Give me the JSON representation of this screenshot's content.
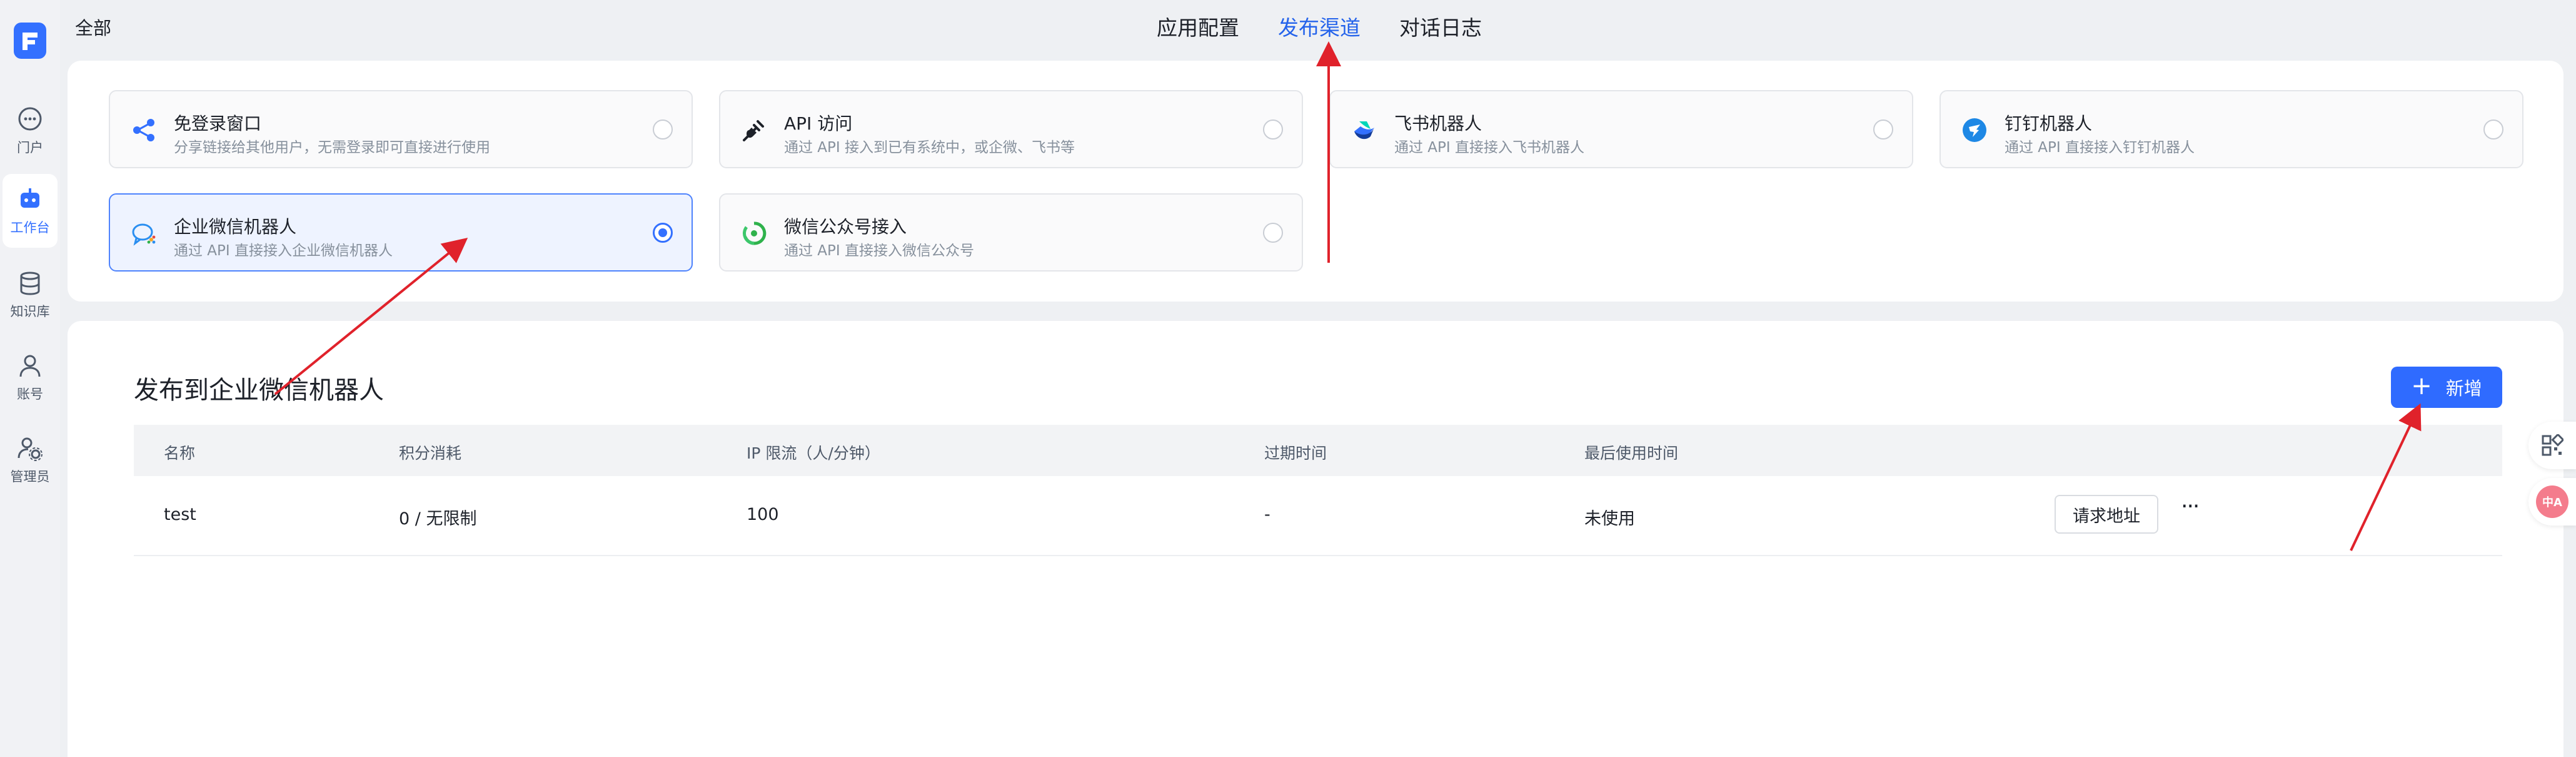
{
  "sidebar": {
    "items": [
      {
        "label": "门户",
        "icon": "chat-bubble-icon"
      },
      {
        "label": "工作台",
        "icon": "robot-icon"
      },
      {
        "label": "知识库",
        "icon": "database-icon"
      },
      {
        "label": "账号",
        "icon": "user-icon"
      },
      {
        "label": "管理员",
        "icon": "admin-gear-icon"
      }
    ],
    "active": "工作台"
  },
  "header": {
    "scope": "全部",
    "tabs": [
      {
        "label": "应用配置"
      },
      {
        "label": "发布渠道"
      },
      {
        "label": "对话日志"
      }
    ],
    "active_tab": "发布渠道"
  },
  "channels": {
    "items": [
      {
        "title": "免登录窗口",
        "desc": "分享链接给其他用户，无需登录即可直接进行使用",
        "icon": "share-icon"
      },
      {
        "title": "API 访问",
        "desc": "通过 API 接入到已有系统中，或企微、飞书等",
        "icon": "plug-icon"
      },
      {
        "title": "飞书机器人",
        "desc": "通过 API 直接接入飞书机器人",
        "icon": "feishu-icon"
      },
      {
        "title": "钉钉机器人",
        "desc": "通过 API 直接接入钉钉机器人",
        "icon": "dingtalk-icon"
      },
      {
        "title": "企业微信机器人",
        "desc": "通过 API 直接接入企业微信机器人",
        "icon": "wecom-icon"
      },
      {
        "title": "微信公众号接入",
        "desc": "通过 API 直接接入微信公众号",
        "icon": "wechat-official-icon"
      }
    ],
    "selected": "企业微信机器人"
  },
  "publish": {
    "title": "发布到企业微信机器人",
    "add_label": "新增",
    "columns": [
      "名称",
      "积分消耗",
      "IP 限流（人/分钟）",
      "过期时间",
      "最后使用时间"
    ],
    "rows": [
      {
        "name": "test",
        "points": "0 / 无限制",
        "ip_limit": "100",
        "expire": "-",
        "last_used": "未使用",
        "action": "请求地址",
        "more": "···"
      }
    ]
  },
  "floating_tools": {
    "translate_label": "中A"
  },
  "colors": {
    "accent": "#3370ff",
    "annotation": "#e0222b"
  }
}
